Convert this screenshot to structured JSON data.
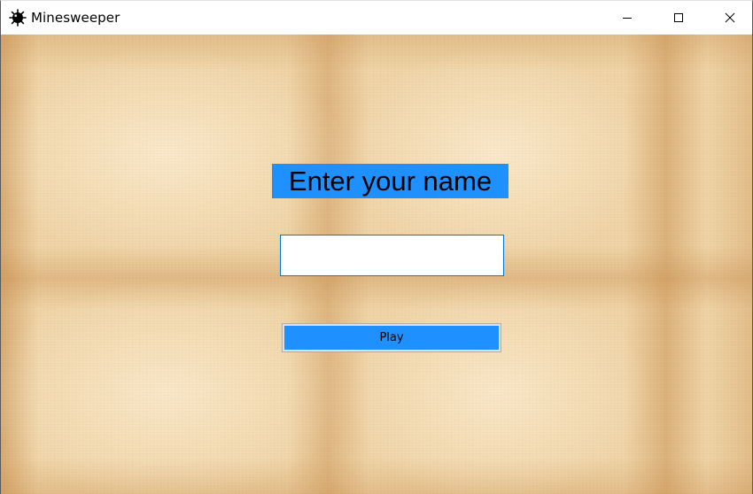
{
  "window": {
    "title": "Minesweeper",
    "app_icon": "mine-icon",
    "controls": {
      "minimize_icon": "minimize-icon",
      "maximize_icon": "maximize-icon",
      "close_icon": "close-icon"
    }
  },
  "form": {
    "prompt": "Enter your name",
    "name_input": {
      "value": "",
      "placeholder": ""
    },
    "play_label": "Play"
  },
  "colors": {
    "accent": "#1e90ff",
    "input_border": "#0078d7",
    "background_paper": "#f0d5a8"
  }
}
